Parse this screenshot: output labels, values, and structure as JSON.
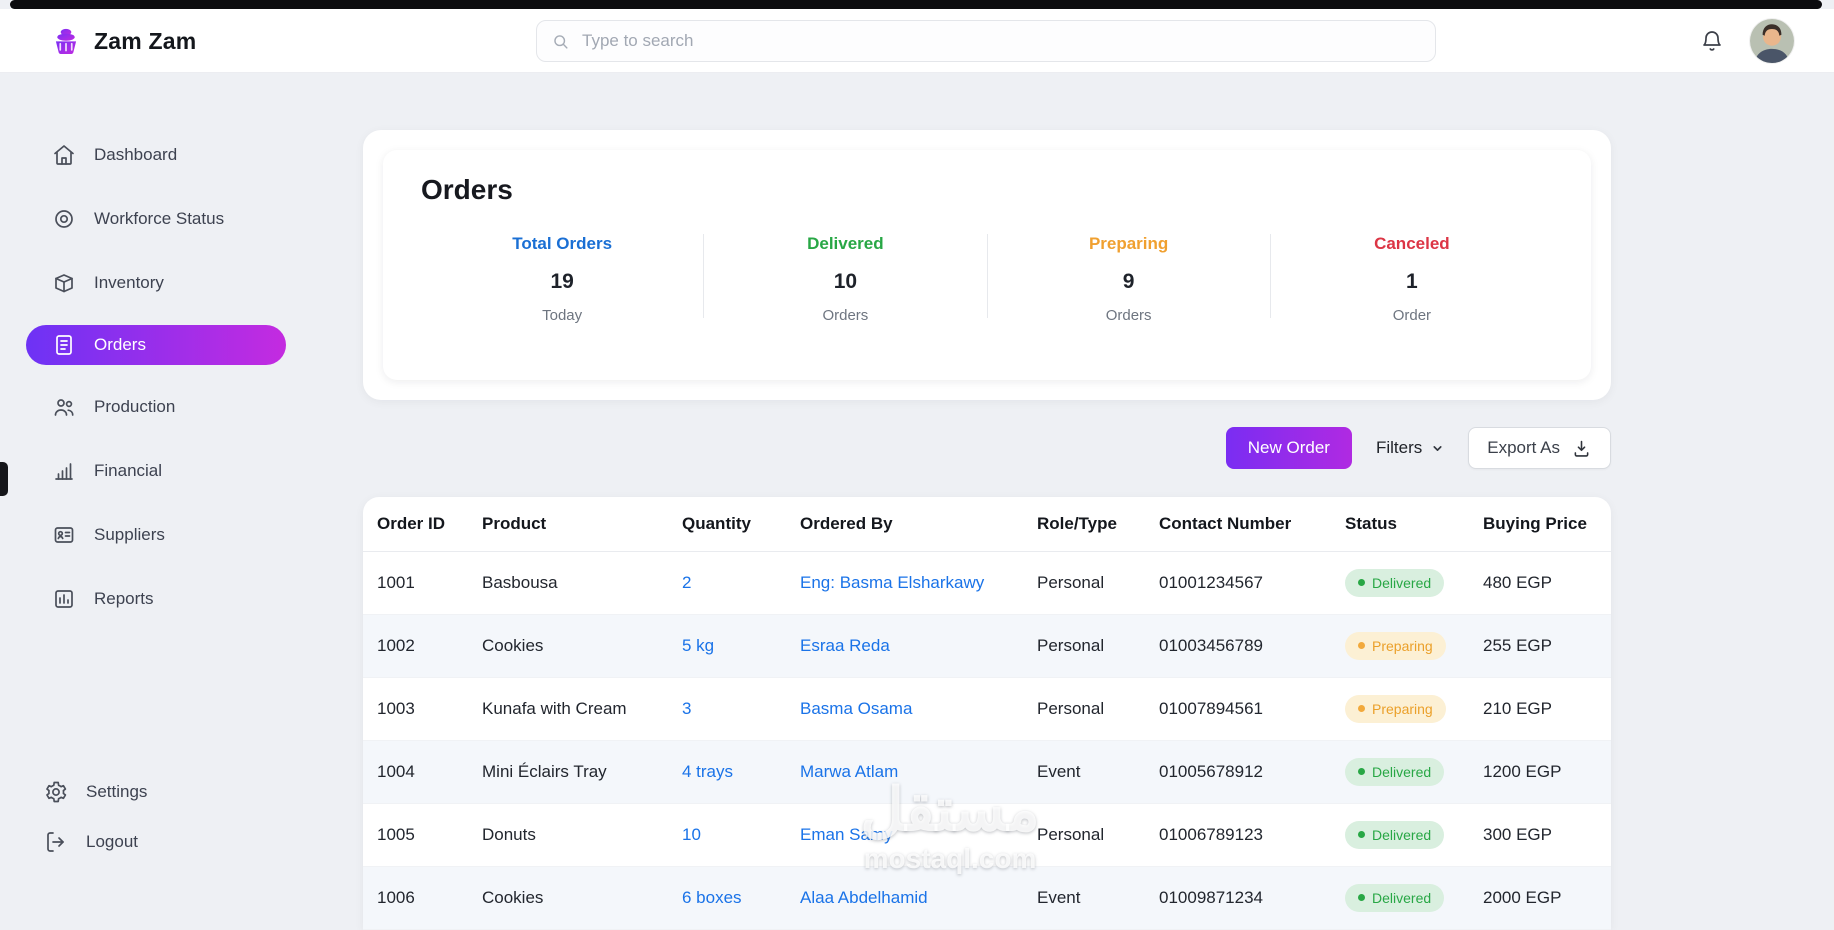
{
  "header": {
    "brand": "Zam Zam",
    "search_placeholder": "Type to search"
  },
  "icons": {
    "logo": "cupcake",
    "search": "magnifier",
    "notifications": "bell",
    "avatar": "user-photo",
    "filters_caret": "chevron-down",
    "export": "download-tray"
  },
  "colors": {
    "accent_gradient_start": "#6d32f5",
    "accent_gradient_end": "#c42be0",
    "total_orders": "#1a6fd4",
    "delivered": "#28a745",
    "preparing": "#f0a030",
    "canceled": "#dc3545",
    "link": "#1a73e8",
    "background": "#eef0f4"
  },
  "sidebar": {
    "items": [
      {
        "label": "Dashboard",
        "icon": "home"
      },
      {
        "label": "Workforce Status",
        "icon": "spiral-disc"
      },
      {
        "label": "Inventory",
        "icon": "box"
      },
      {
        "label": "Orders",
        "icon": "receipt",
        "active": true
      },
      {
        "label": "Production",
        "icon": "people"
      },
      {
        "label": "Financial",
        "icon": "bar-chart"
      },
      {
        "label": "Suppliers",
        "icon": "id-card"
      },
      {
        "label": "Reports",
        "icon": "report-board"
      }
    ],
    "footer_items": [
      {
        "label": "Settings",
        "icon": "gear"
      },
      {
        "label": "Logout",
        "icon": "logout"
      }
    ]
  },
  "stats": {
    "title": "Orders",
    "cards": [
      {
        "label": "Total Orders",
        "value": "19",
        "sub": "Today",
        "color": "#1a6fd4"
      },
      {
        "label": "Delivered",
        "value": "10",
        "sub": "Orders",
        "color": "#28a745"
      },
      {
        "label": "Preparing",
        "value": "9",
        "sub": "Orders",
        "color": "#f0a030"
      },
      {
        "label": "Canceled",
        "value": "1",
        "sub": "Order",
        "color": "#dc3545"
      }
    ]
  },
  "actions": {
    "new_order_label": "New Order",
    "filters_label": "Filters",
    "export_label": "Export As"
  },
  "table": {
    "headers": [
      "Order ID",
      "Product",
      "Quantity",
      "Ordered By",
      "Role/Type",
      "Contact Number",
      "Status",
      "Buying Price"
    ],
    "rows": [
      {
        "id": "1001",
        "product": "Basbousa",
        "quantity": "2",
        "ordered_by": "Eng: Basma Elsharkawy",
        "role": "Personal",
        "contact": "01001234567",
        "status": "Delivered",
        "status_key": "delivered",
        "price": "480 EGP"
      },
      {
        "id": "1002",
        "product": "Cookies",
        "quantity": "5 kg",
        "ordered_by": "Esraa Reda",
        "role": "Personal",
        "contact": "01003456789",
        "status": "Preparing",
        "status_key": "preparing",
        "price": "255 EGP"
      },
      {
        "id": "1003",
        "product": "Kunafa with Cream",
        "quantity": "3",
        "ordered_by": "Basma Osama",
        "role": "Personal",
        "contact": "01007894561",
        "status": "Preparing",
        "status_key": "preparing",
        "price": "210 EGP"
      },
      {
        "id": "1004",
        "product": "Mini Éclairs Tray",
        "quantity": "4 trays",
        "ordered_by": "Marwa Atlam",
        "role": "Event",
        "contact": "01005678912",
        "status": "Delivered",
        "status_key": "delivered",
        "price": "1200 EGP"
      },
      {
        "id": "1005",
        "product": "Donuts",
        "quantity": "10",
        "ordered_by": "Eman Samy",
        "role": "Personal",
        "contact": "01006789123",
        "status": "Delivered",
        "status_key": "delivered",
        "price": "300 EGP"
      },
      {
        "id": "1006",
        "product": "Cookies",
        "quantity": "6 boxes",
        "ordered_by": "Alaa Abdelhamid",
        "role": "Event",
        "contact": "01009871234",
        "status": "Delivered",
        "status_key": "delivered",
        "price": "2000 EGP"
      }
    ]
  },
  "watermark": {
    "line1": "مستقل",
    "line2": "mostaql.com"
  }
}
